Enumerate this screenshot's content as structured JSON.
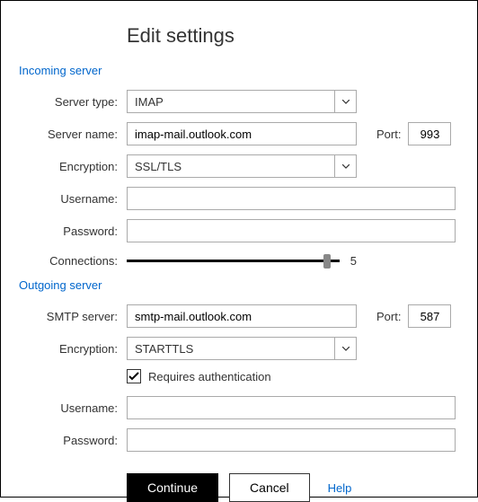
{
  "title": "Edit settings",
  "incoming": {
    "header": "Incoming server",
    "server_type_label": "Server type:",
    "server_type_value": "IMAP",
    "server_name_label": "Server name:",
    "server_name_value": "imap-mail.outlook.com",
    "port_label": "Port:",
    "port_value": "993",
    "encryption_label": "Encryption:",
    "encryption_value": "SSL/TLS",
    "username_label": "Username:",
    "username_value": "",
    "password_label": "Password:",
    "password_value": "",
    "connections_label": "Connections:",
    "connections_value": "5"
  },
  "outgoing": {
    "header": "Outgoing server",
    "smtp_label": "SMTP server:",
    "smtp_value": "smtp-mail.outlook.com",
    "port_label": "Port:",
    "port_value": "587",
    "encryption_label": "Encryption:",
    "encryption_value": "STARTTLS",
    "requires_auth_label": "Requires authentication",
    "requires_auth_checked": true,
    "username_label": "Username:",
    "username_value": "",
    "password_label": "Password:",
    "password_value": ""
  },
  "buttons": {
    "continue": "Continue",
    "cancel": "Cancel",
    "help": "Help"
  }
}
